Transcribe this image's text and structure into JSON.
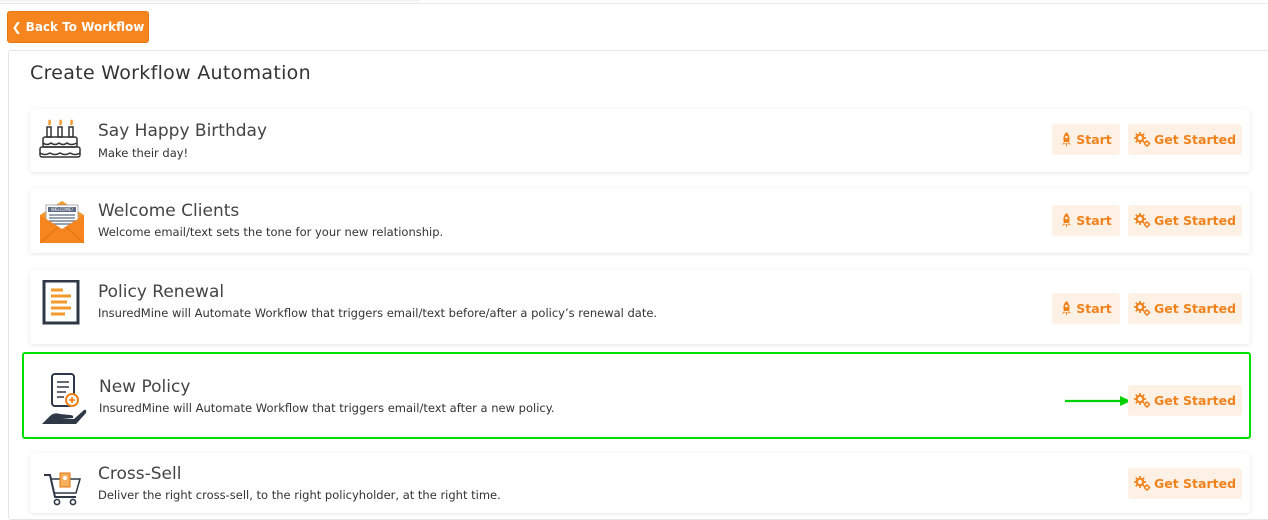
{
  "header": {
    "back_label": "Back To Workflow"
  },
  "page": {
    "title": "Create Workflow Automation"
  },
  "cards": [
    {
      "title": "Say Happy Birthday",
      "desc": "Make their day!",
      "start_label": "Start",
      "get_started_label": "Get Started",
      "icon": "birthday-cake-icon"
    },
    {
      "title": "Welcome Clients",
      "desc": "Welcome email/text sets the tone for your new relationship.",
      "start_label": "Start",
      "get_started_label": "Get Started",
      "icon": "welcome-envelope-icon"
    },
    {
      "title": "Policy Renewal",
      "desc": "InsuredMine will Automate Workflow that triggers email/text before/after a policy’s renewal date.",
      "start_label": "Start",
      "get_started_label": "Get Started",
      "icon": "policy-document-icon"
    },
    {
      "title": "New Policy",
      "desc": "InsuredMine will Automate Workflow that triggers email/text after a new policy.",
      "get_started_label": "Get Started",
      "icon": "new-policy-hand-icon"
    },
    {
      "title": "Cross-Sell",
      "desc": "Deliver the right cross-sell, to the right policyholder, at the right time.",
      "get_started_label": "Get Started",
      "icon": "shopping-cart-icon"
    }
  ],
  "colors": {
    "accent": "#f6851f",
    "button_bg": "#fdf1e6",
    "highlight": "#00e000"
  }
}
